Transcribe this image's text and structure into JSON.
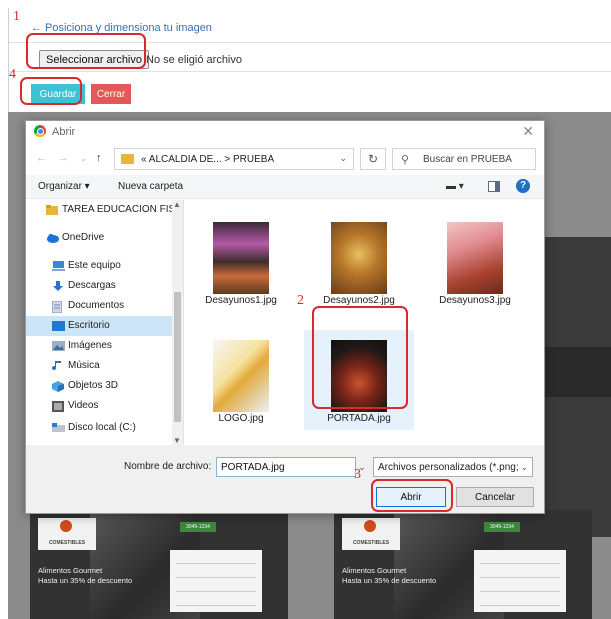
{
  "page": {
    "back_link": "Posiciona y dimensiona tu imagen",
    "select_file_button": "Seleccionar archivo",
    "no_file_text": "No se eligió archivo",
    "save_button": "Guardar",
    "close_button": "Cerrar"
  },
  "steps": [
    "1",
    "2",
    "3",
    "4"
  ],
  "background_cards": {
    "brand": "COMESTIBLES",
    "phone": "3045-1234",
    "promo_line1": "Alimentos Gourmet",
    "promo_line2": "Hasta un 35% de descuento"
  },
  "dialog": {
    "title": "Abrir",
    "address_path": "« ALCALDIA DE... > PRUEBA",
    "search_placeholder": "Buscar en PRUEBA",
    "toolbar": {
      "organize": "Organizar ▾",
      "new_folder": "Nueva carpeta"
    },
    "nav_items": [
      {
        "label": "TAREA EDUCACION FIS",
        "icon": "folder-icon"
      },
      {
        "label": "OneDrive",
        "icon": "cloud-icon"
      },
      {
        "label": "Este equipo",
        "icon": "computer-icon"
      },
      {
        "label": "Descargas",
        "icon": "download-icon"
      },
      {
        "label": "Documentos",
        "icon": "document-icon"
      },
      {
        "label": "Escritorio",
        "icon": "desktop-icon",
        "selected": true
      },
      {
        "label": "Imágenes",
        "icon": "pictures-icon"
      },
      {
        "label": "Música",
        "icon": "music-icon"
      },
      {
        "label": "Objetos 3D",
        "icon": "cube-icon"
      },
      {
        "label": "Videos",
        "icon": "video-icon"
      },
      {
        "label": "Disco local (C:)",
        "icon": "drive-icon"
      }
    ],
    "files": [
      {
        "name": "Desayunos1.jpg"
      },
      {
        "name": "Desayunos2.jpg"
      },
      {
        "name": "Desayunos3.jpg"
      },
      {
        "name": "LOGO.jpg"
      },
      {
        "name": "PORTADA.jpg",
        "selected": true
      }
    ],
    "filename_label": "Nombre de archivo:",
    "filename_value": "PORTADA.jpg",
    "filetype": "Archivos personalizados (*.png;",
    "open_button": "Abrir",
    "cancel_button": "Cancelar"
  },
  "colors": {
    "highlight": "#d9282e",
    "save": "#3cc2d5",
    "close": "#e55858",
    "selection": "#cce4f7"
  }
}
